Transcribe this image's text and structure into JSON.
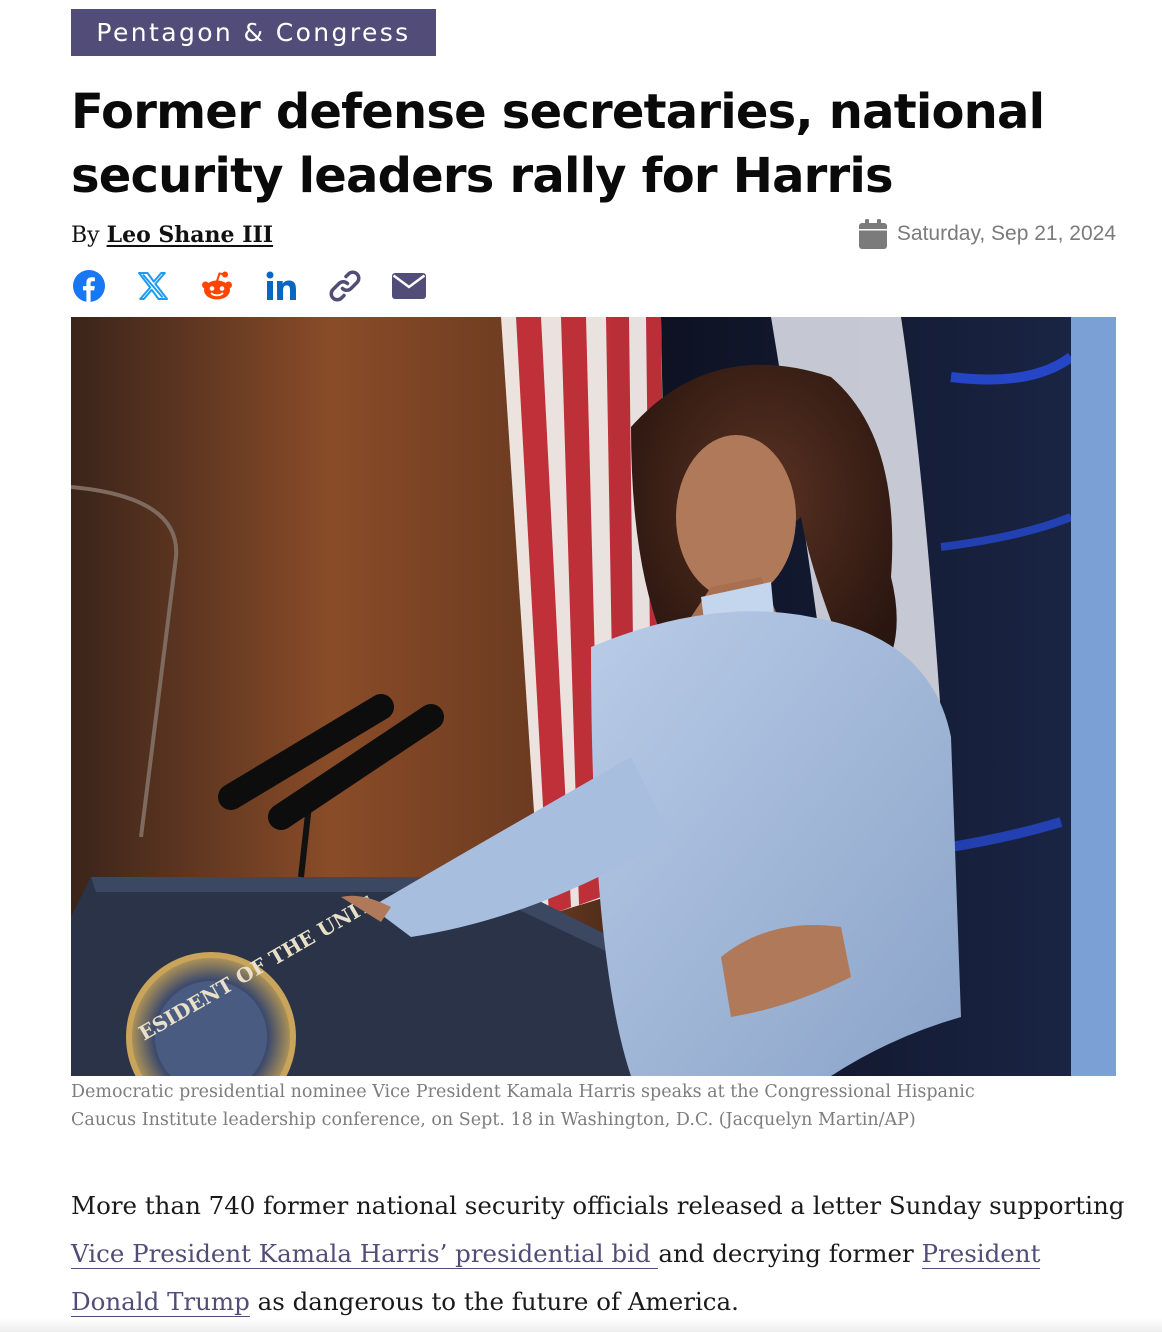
{
  "section_tag": "Pentagon & Congress",
  "headline": {
    "line1": "Former defense secretaries, national",
    "line2": "security leaders rally for Harris"
  },
  "byline": {
    "prefix": "By",
    "author": "Leo Shane III"
  },
  "date": {
    "icon": "calendar-icon",
    "text": "Saturday, Sep 21, 2024"
  },
  "share_icons": [
    "facebook-icon",
    "x-icon",
    "reddit-icon",
    "linkedin-icon",
    "link-icon",
    "email-icon"
  ],
  "colors": {
    "accent": "#514d78",
    "facebook": "#1877f2",
    "x": "#1d9bf0",
    "reddit": "#ff4500",
    "linkedin": "#0a66c2",
    "date_gray": "#7b7b7b"
  },
  "photo": {
    "caption_line1": "Democratic presidential nominee Vice President Kamala Harris speaks at the Congressional Hispanic",
    "caption_line2": "Caucus Institute leadership conference, on Sept. 18 in Washington, D.C. (Jacquelyn Martin/AP)",
    "seal_text": "ESIDENT OF THE UNIT"
  },
  "body": {
    "p1_part1": "More than 740 former national security officials released a letter Sunday supporting ",
    "p1_link1": "Vice President Kamala Harris’ presidential bid ",
    "p1_part2": "and decrying former ",
    "p1_link2": "President Donald Trump",
    "p1_part3": " as dangerous to the future of America."
  }
}
